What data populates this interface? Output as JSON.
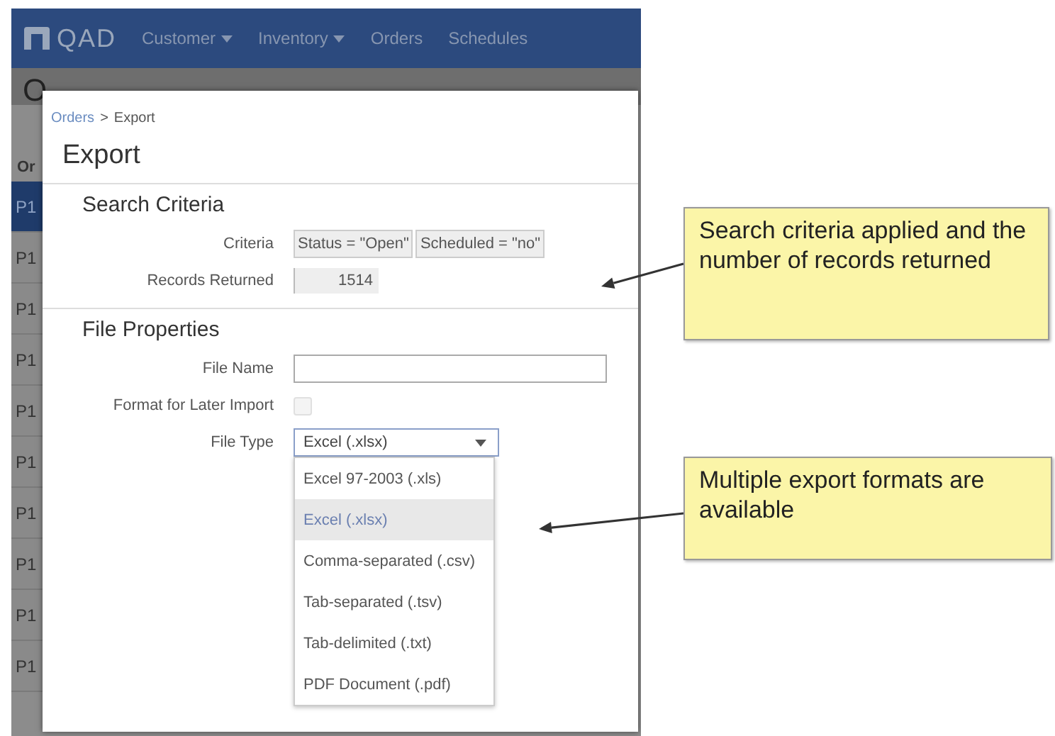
{
  "app": {
    "logo": "QAD",
    "nav": [
      {
        "label": "Customer",
        "dropdown": true
      },
      {
        "label": "Inventory",
        "dropdown": true
      },
      {
        "label": "Orders",
        "dropdown": false
      },
      {
        "label": "Schedules",
        "dropdown": false
      }
    ],
    "page_title": "O",
    "list_header": "Or",
    "rows": [
      {
        "label": "P1",
        "selected": true
      },
      {
        "label": "P1",
        "selected": false
      },
      {
        "label": "P1",
        "selected": false
      },
      {
        "label": "P1",
        "selected": false
      },
      {
        "label": "P1",
        "selected": false
      },
      {
        "label": "P1",
        "selected": false
      },
      {
        "label": "P1",
        "selected": false
      },
      {
        "label": "P1",
        "selected": false
      },
      {
        "label": "P1",
        "selected": false
      },
      {
        "label": "P1",
        "selected": false
      }
    ]
  },
  "dialog": {
    "breadcrumb": {
      "parent": "Orders",
      "separator": ">",
      "current": "Export"
    },
    "title": "Export",
    "sections": [
      {
        "title": "Search Criteria",
        "fields": [
          {
            "kind": "chips",
            "label": "Criteria",
            "chips": [
              "Status = \"Open\"",
              "Scheduled = \"no\""
            ]
          },
          {
            "kind": "readonly",
            "label": "Records Returned",
            "value": "1514"
          }
        ]
      },
      {
        "title": "File Properties",
        "fields": [
          {
            "kind": "text",
            "label": "File Name"
          },
          {
            "kind": "checkbox",
            "label": "Format for Later Import",
            "checked": false,
            "disabled": true
          },
          {
            "kind": "select",
            "label": "File Type",
            "value": "Excel (.xlsx)",
            "expanded": true,
            "options": [
              {
                "label": "Excel 97-2003 (.xls)",
                "selected": false
              },
              {
                "label": "Excel (.xlsx)",
                "selected": true
              },
              {
                "label": "Comma-separated (.csv)",
                "selected": false
              },
              {
                "label": "Tab-separated (.tsv)",
                "selected": false
              },
              {
                "label": "Tab-delimited (.txt)",
                "selected": false
              },
              {
                "label": "PDF Document (.pdf)",
                "selected": false
              }
            ]
          }
        ]
      }
    ]
  },
  "callouts": [
    {
      "text": "Search criteria applied and the number of records returned"
    },
    {
      "text": "Multiple export formats are available"
    }
  ]
}
